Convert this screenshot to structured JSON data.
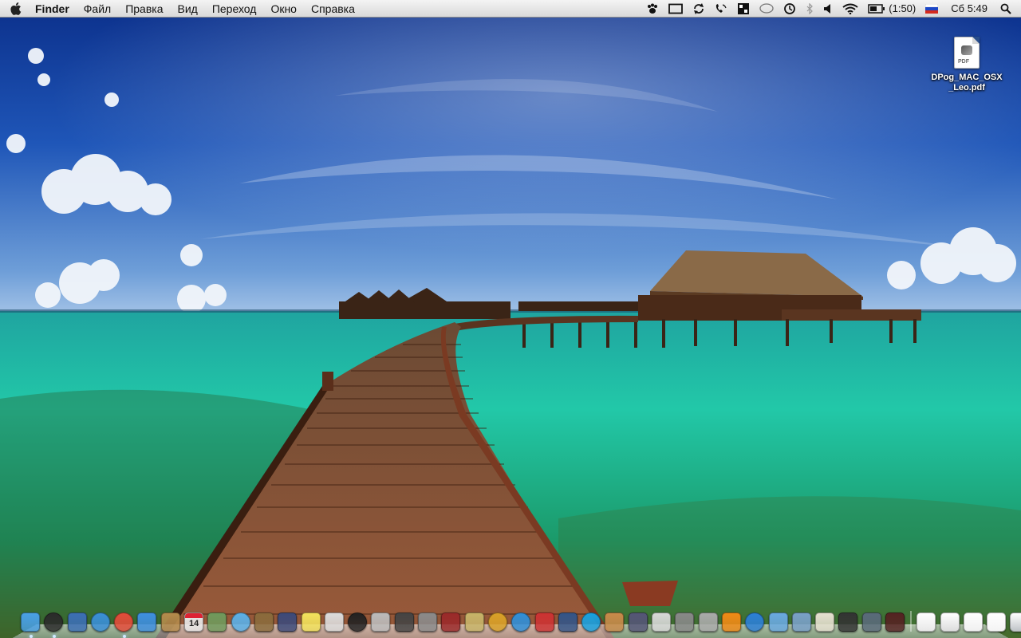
{
  "menubar": {
    "apple_icon": "apple-icon",
    "app_name": "Finder",
    "items": [
      "Файл",
      "Правка",
      "Вид",
      "Переход",
      "Окно",
      "Справка"
    ],
    "status": {
      "battery_text": "(1:50)",
      "clock": "Сб 5:49",
      "icons": [
        "paw-icon",
        "display-icon",
        "sync-icon",
        "phone-icon",
        "keyboard-icon",
        "speech-bubble-icon",
        "time-machine-icon",
        "bluetooth-icon",
        "volume-icon",
        "wifi-icon",
        "battery-icon",
        "russian-flag-icon",
        "spotlight-icon"
      ]
    }
  },
  "desktop": {
    "file": {
      "name": "DPog_MAC_OSX_Leo.pdf",
      "badge": "PDF",
      "icon": "pdf-document-icon"
    }
  },
  "dock": {
    "calendar_date": "14",
    "items": [
      {
        "name": "finder",
        "color": "#4aa0e6",
        "running": true
      },
      {
        "name": "dashboard",
        "color": "#2b2b2b",
        "running": true
      },
      {
        "name": "xcode",
        "color": "#3c6fb5",
        "running": false
      },
      {
        "name": "safari",
        "color": "#3a8fd8",
        "running": false
      },
      {
        "name": "chrome",
        "color": "#e44c3a",
        "running": true
      },
      {
        "name": "ichat",
        "color": "#3f8fe0",
        "running": false
      },
      {
        "name": "address-book",
        "color": "#b48b4c",
        "running": false
      },
      {
        "name": "ical",
        "color": "#e9e9e9",
        "running": false
      },
      {
        "name": "iphoto",
        "color": "#6f9a5c",
        "running": false
      },
      {
        "name": "itunes",
        "color": "#5ab0e8",
        "running": false
      },
      {
        "name": "preview",
        "color": "#8a6b3c",
        "running": false
      },
      {
        "name": "photo-booth",
        "color": "#3c4a7a",
        "running": false
      },
      {
        "name": "stickies",
        "color": "#f2e25c",
        "running": false
      },
      {
        "name": "textedit",
        "color": "#dcdcdc",
        "running": false
      },
      {
        "name": "camera",
        "color": "#222222",
        "running": false
      },
      {
        "name": "image-capture",
        "color": "#bbbbbb",
        "running": false
      },
      {
        "name": "expose",
        "color": "#444444",
        "running": false
      },
      {
        "name": "system-preferences",
        "color": "#8a8a8a",
        "running": false
      },
      {
        "name": "dictionary",
        "color": "#9a2a2a",
        "running": false
      },
      {
        "name": "torch-app",
        "color": "#c7b469",
        "running": false
      },
      {
        "name": "audio-app",
        "color": "#d9a128",
        "running": false
      },
      {
        "name": "forward-app",
        "color": "#2f8fd9",
        "running": false
      },
      {
        "name": "clean-app",
        "color": "#cc3333",
        "running": false
      },
      {
        "name": "tux-app",
        "color": "#335588",
        "running": false
      },
      {
        "name": "skype",
        "color": "#18a1e0",
        "running": false
      },
      {
        "name": "utility-app",
        "color": "#c98a4a",
        "running": false
      },
      {
        "name": "quill-app",
        "color": "#555577",
        "running": false
      },
      {
        "name": "chart-app",
        "color": "#d8d8d8",
        "running": false
      },
      {
        "name": "stack-app",
        "color": "#888888",
        "running": false
      },
      {
        "name": "robot-app",
        "color": "#aaaaaa",
        "running": false
      },
      {
        "name": "vlc",
        "color": "#f08a16",
        "running": false
      },
      {
        "name": "quicktime",
        "color": "#2c7fd6",
        "running": false
      },
      {
        "name": "bubble-app",
        "color": "#6aa9e0",
        "running": false
      },
      {
        "name": "network-app",
        "color": "#7aa0c8",
        "running": false
      },
      {
        "name": "gallery-app",
        "color": "#e6e0d0",
        "running": false
      },
      {
        "name": "photo-app",
        "color": "#333333",
        "running": false
      },
      {
        "name": "screen-app",
        "color": "#5a6a7a",
        "running": false
      },
      {
        "name": "spaces-app",
        "color": "#552222",
        "running": false
      }
    ],
    "stacks": [
      {
        "name": "documents-stack",
        "color": "#e8e8e8"
      },
      {
        "name": "downloads-stack",
        "color": "#dddddd"
      },
      {
        "name": "files-stack",
        "color": "#f0f0f0"
      },
      {
        "name": "mail-stack",
        "color": "#f4f4f4"
      },
      {
        "name": "trash",
        "color": "#c0c4c8"
      }
    ]
  }
}
